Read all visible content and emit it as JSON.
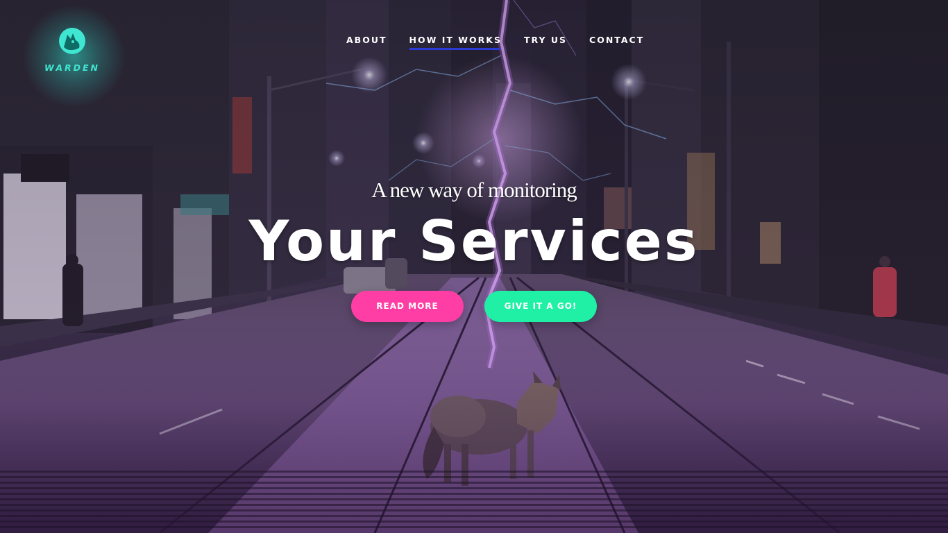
{
  "brand": {
    "name": "WARDEN",
    "icon": "wolf-head-logo-icon",
    "color": "#3fe6d2"
  },
  "nav": {
    "items": [
      {
        "label": "ABOUT",
        "active": false
      },
      {
        "label": "HOW IT WORKS",
        "active": true
      },
      {
        "label": "TRY US",
        "active": false
      },
      {
        "label": "CONTACT",
        "active": false
      }
    ],
    "active_underline_color": "#2a3bd6"
  },
  "hero": {
    "tagline": "A new way of monitoring",
    "headline": "Your Services",
    "background": "night-city-street-lightning-coyote-image"
  },
  "buttons": {
    "read_more": {
      "label": "READ MORE",
      "color": "#ff3ea5"
    },
    "give_it_a_go": {
      "label": "GIVE IT A GO!",
      "color": "#1ff0a6"
    }
  }
}
